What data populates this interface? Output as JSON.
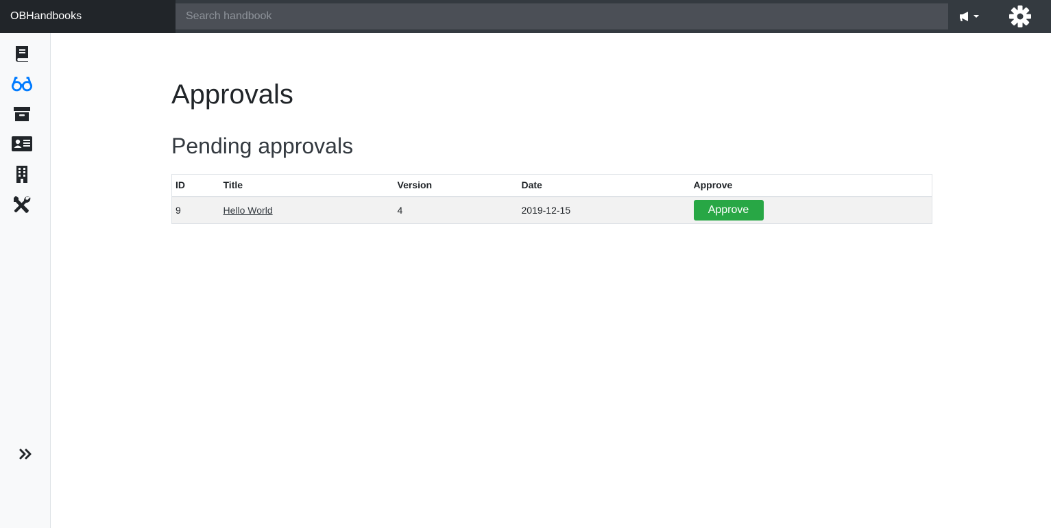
{
  "app": {
    "brand": "OBHandbooks"
  },
  "search": {
    "placeholder": "Search handbook"
  },
  "header_icons": [
    "megaphone-icon",
    "gear-icon"
  ],
  "sidebar": {
    "items": [
      {
        "icon": "book-icon",
        "active": false
      },
      {
        "icon": "glasses-icon",
        "active": true
      },
      {
        "icon": "archive-icon",
        "active": false
      },
      {
        "icon": "id-card-icon",
        "active": false
      },
      {
        "icon": "building-icon",
        "active": false
      },
      {
        "icon": "tools-icon",
        "active": false
      }
    ],
    "expand_icon": "angle-double-right-icon"
  },
  "page": {
    "title": "Approvals",
    "section_title": "Pending approvals"
  },
  "table": {
    "headers": [
      "ID",
      "Title",
      "Version",
      "Date",
      "Approve"
    ],
    "rows": [
      {
        "id": "9",
        "title": "Hello World",
        "version": "4",
        "date": "2019-12-15",
        "action": "Approve"
      }
    ]
  },
  "colors": {
    "topbar": "#343a40",
    "brand_bg": "#212529",
    "active_icon": "#007bff",
    "approve_button": "#28a745"
  }
}
